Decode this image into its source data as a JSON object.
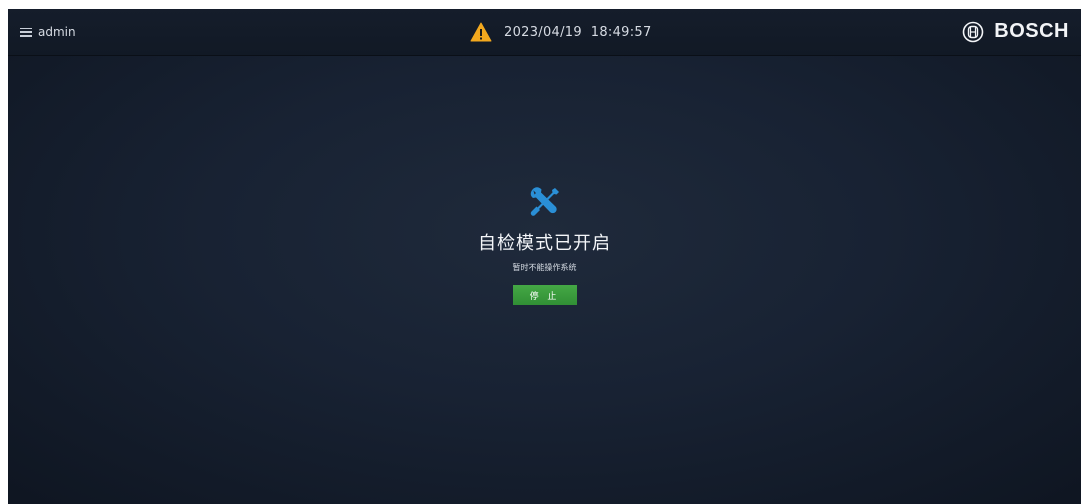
{
  "header": {
    "menu_icon": "hamburger-icon",
    "user": "admin",
    "status_icon": "warning-icon",
    "warning_color": "#f2a81e",
    "datetime": "2023/04/19  18:49:57",
    "brand_icon": "bosch-logo-icon",
    "brand_name": "BOSCH"
  },
  "main": {
    "icon": "tools-icon",
    "icon_color": "#2a8fd6",
    "title": "自检模式已开启",
    "subtitle": "暂时不能操作系统",
    "stop_button": "停 止",
    "button_color": "#3c9c3f"
  }
}
